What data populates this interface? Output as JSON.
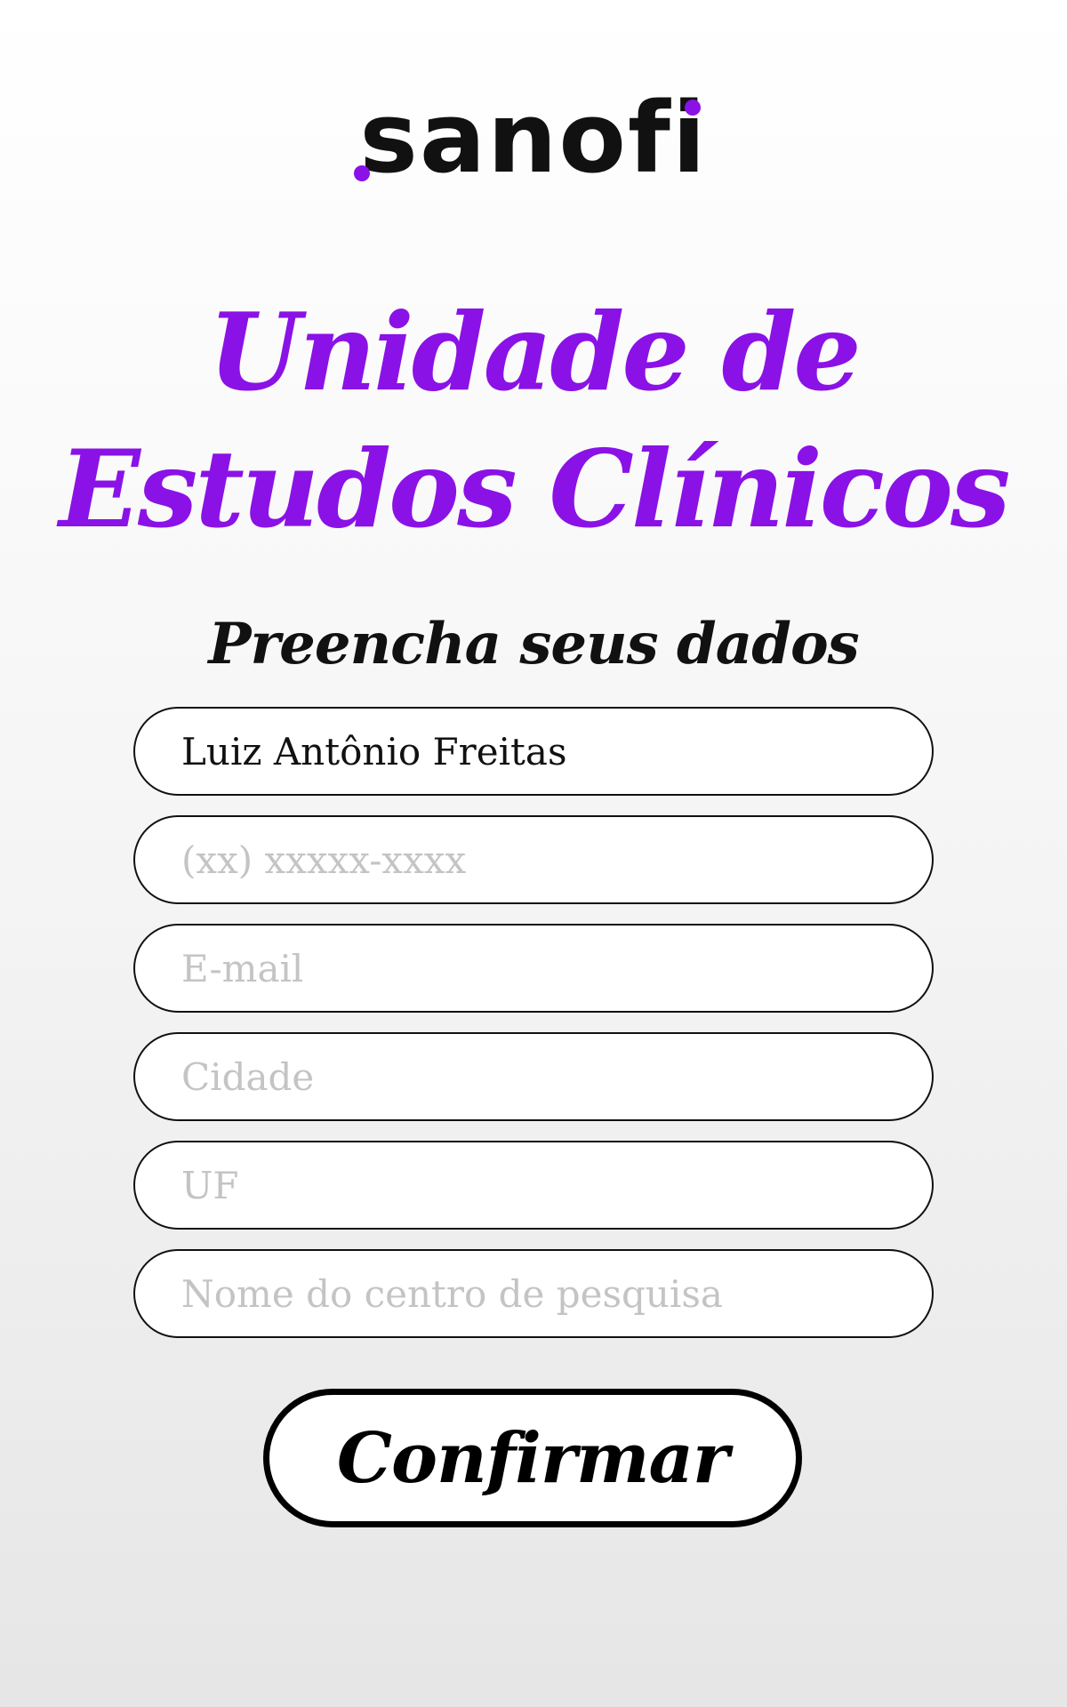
{
  "brand": {
    "logo_text": "sanofi",
    "accent_color": "#8a12e6"
  },
  "header": {
    "title_line1": "Unidade de",
    "title_line2": "Estudos Clínicos",
    "subtitle": "Preencha seus dados"
  },
  "form": {
    "name": {
      "value": "Luiz Antônio Freitas",
      "placeholder": ""
    },
    "phone": {
      "value": "",
      "placeholder": "(xx) xxxxx-xxxx"
    },
    "email": {
      "value": "",
      "placeholder": "E-mail"
    },
    "city": {
      "value": "",
      "placeholder": "Cidade"
    },
    "state": {
      "value": "",
      "placeholder": "UF"
    },
    "research_center": {
      "value": "",
      "placeholder": "Nome do centro de pesquisa"
    },
    "confirm_label": "Confirmar"
  }
}
